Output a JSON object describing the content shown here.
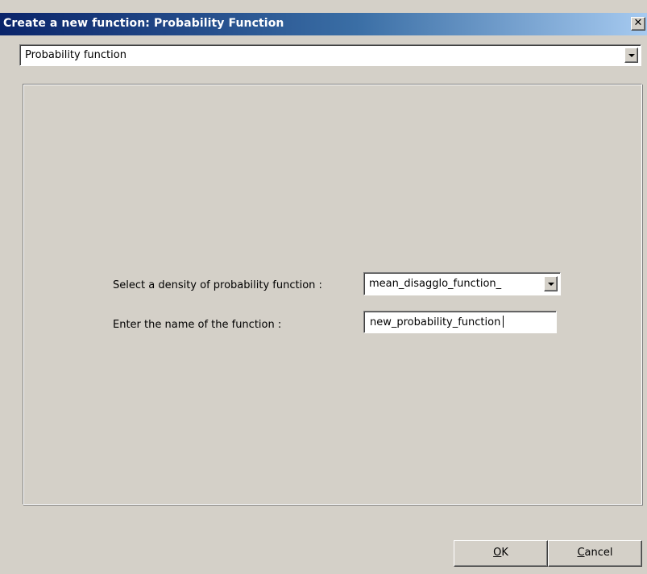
{
  "window": {
    "title": "Create a new function: Probability Function",
    "close_icon": "close-icon"
  },
  "function_type": {
    "selected": "Probability function"
  },
  "form": {
    "density_label": "Select a density of probability function :",
    "density_selected": "mean_disagglo_function_",
    "name_label": "Enter the name of the function :",
    "name_value": "new_probability_function"
  },
  "buttons": {
    "ok_mnemonic": "O",
    "ok_rest": "K",
    "cancel_mnemonic": "C",
    "cancel_rest": "ancel"
  },
  "colors": {
    "titlebar_start": "#0a246a",
    "titlebar_end": "#a6caf0",
    "face": "#d4d0c8"
  }
}
